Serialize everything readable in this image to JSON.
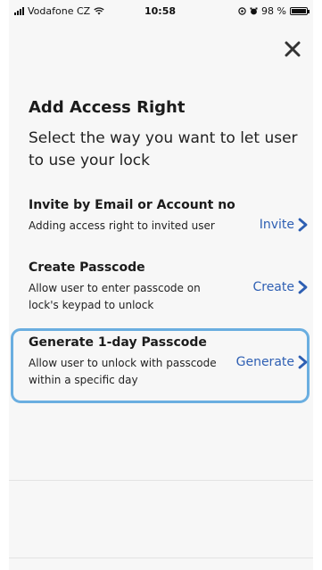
{
  "status_bar": {
    "carrier": "Vodafone CZ",
    "time": "10:58",
    "battery_percent": "98 %",
    "battery_level": 0.98
  },
  "header": {
    "close_icon": "close-icon"
  },
  "page": {
    "title": "Add Access Right",
    "subtitle": "Select the way you want to let user to use your lock"
  },
  "options": [
    {
      "title": "Invite by Email or Account no",
      "description": "Adding access right to invited user",
      "action": "Invite"
    },
    {
      "title": "Create Passcode",
      "description": "Allow user to enter passcode on lock's keypad to unlock",
      "action": "Create"
    },
    {
      "title": "Generate 1-day Passcode",
      "description": "Allow user to unlock with passcode within a specific day",
      "action": "Generate"
    }
  ],
  "colors": {
    "accent": "#2e5fb3",
    "highlight_border": "#6aaee0",
    "background": "#f7f7f7"
  }
}
